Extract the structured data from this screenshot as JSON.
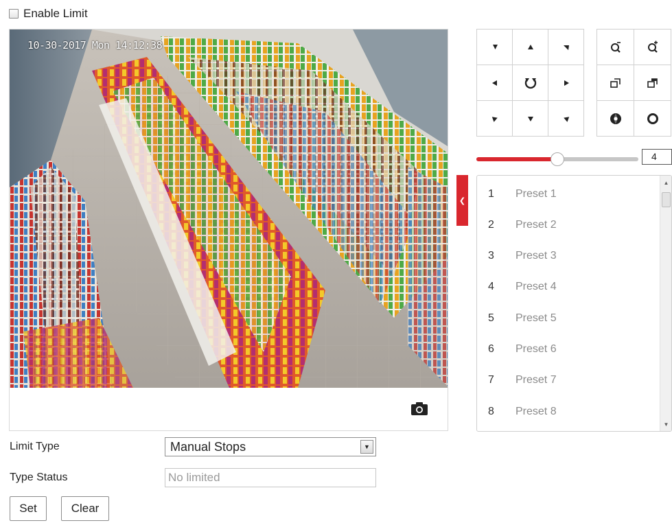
{
  "enable_limit": {
    "label": "Enable Limit",
    "checked": false
  },
  "preview": {
    "osd_timestamp": "10-30-2017 Mon 14:12:38",
    "capture_icon": "camera-icon"
  },
  "ptz": {
    "direction_icons": [
      "arrow-up-left-icon",
      "arrow-up-icon",
      "arrow-up-right-icon",
      "arrow-left-icon",
      "auto-pan-icon",
      "arrow-right-icon",
      "arrow-down-left-icon",
      "arrow-down-icon",
      "arrow-down-right-icon"
    ],
    "lens_icons": [
      "zoom-out-icon",
      "zoom-in-icon",
      "focus-near-icon",
      "focus-far-icon",
      "iris-close-icon",
      "iris-open-icon"
    ],
    "speed": {
      "value": "4",
      "min": 1,
      "max": 7,
      "fill_color": "#d9272e"
    }
  },
  "presets": [
    {
      "num": "1",
      "name": "Preset 1"
    },
    {
      "num": "2",
      "name": "Preset 2"
    },
    {
      "num": "3",
      "name": "Preset 3"
    },
    {
      "num": "4",
      "name": "Preset 4"
    },
    {
      "num": "5",
      "name": "Preset 5"
    },
    {
      "num": "6",
      "name": "Preset 6"
    },
    {
      "num": "7",
      "name": "Preset 7"
    },
    {
      "num": "8",
      "name": "Preset 8"
    }
  ],
  "form": {
    "limit_type_label": "Limit Type",
    "limit_type_value": "Manual Stops",
    "type_status_label": "Type Status",
    "type_status_value": "No limited"
  },
  "buttons": {
    "set": "Set",
    "clear": "Clear"
  },
  "colors": {
    "accent": "#d9272e"
  }
}
